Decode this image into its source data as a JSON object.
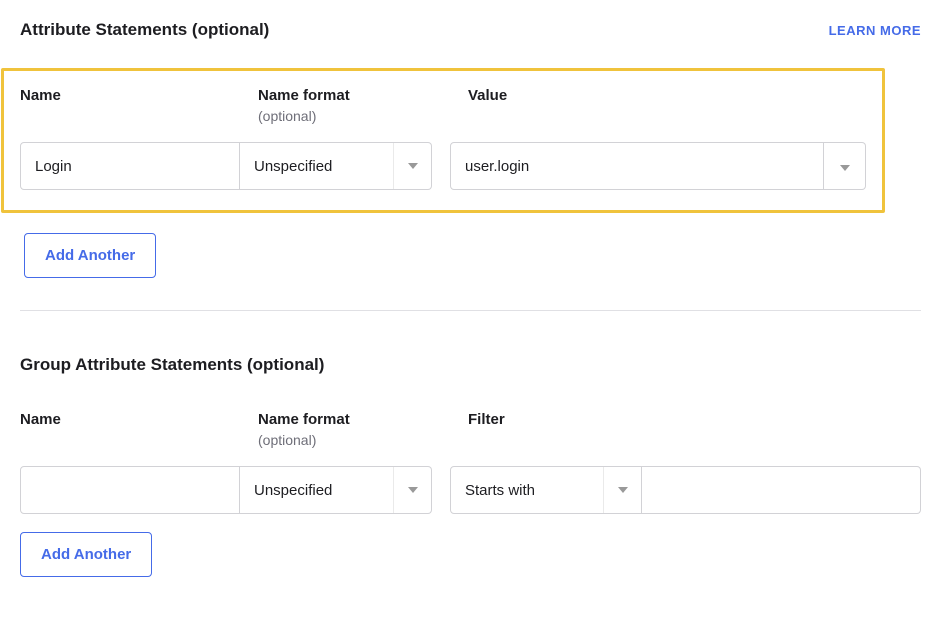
{
  "attributeSection": {
    "title": "Attribute Statements (optional)",
    "learnMore": "LEARN MORE",
    "headers": {
      "name": "Name",
      "nameFormat": "Name format",
      "nameFormatSub": "(optional)",
      "value": "Value"
    },
    "row": {
      "name": "Login",
      "nameFormat": "Unspecified",
      "value": "user.login"
    },
    "addAnother": "Add Another"
  },
  "groupSection": {
    "title": "Group Attribute Statements (optional)",
    "headers": {
      "name": "Name",
      "nameFormat": "Name format",
      "nameFormatSub": "(optional)",
      "filter": "Filter"
    },
    "row": {
      "name": "",
      "nameFormat": "Unspecified",
      "filterType": "Starts with",
      "filterValue": ""
    },
    "addAnother": "Add Another"
  }
}
